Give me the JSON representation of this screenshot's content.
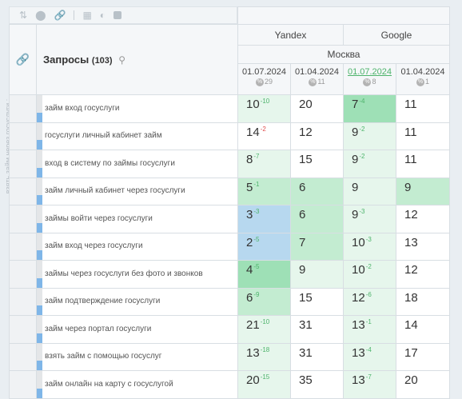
{
  "side_label": "взять займ через госуслуги :",
  "toolbar": {
    "icons": [
      "sort-icon",
      "toggle-icon",
      "link-icon",
      "calculator-icon",
      "contrast-icon",
      "font-icon"
    ]
  },
  "header": {
    "link_icon": "🔗",
    "title": "Запросы",
    "count": "(103)",
    "search_icon": "⚲",
    "engines": [
      "Yandex",
      "Google"
    ],
    "region": "Москва",
    "dates": [
      {
        "date": "01.07.2024",
        "count": "29",
        "highlighted": false
      },
      {
        "date": "01.04.2024",
        "count": "11",
        "highlighted": false
      },
      {
        "date": "01.07.2024",
        "count": "8",
        "highlighted": true
      },
      {
        "date": "01.04.2024",
        "count": "1",
        "highlighted": false
      }
    ],
    "badge_glyph": "%"
  },
  "colors": {
    "green_light": "#e6f6ec",
    "green_mid": "#c3ecd1",
    "green_strong": "#9ee0b6",
    "blue": "#b7d8ef",
    "white": "#ffffff"
  },
  "rows": [
    {
      "query": "займ вход госуслуги",
      "cells": [
        {
          "v": "10",
          "d": "-10",
          "bg": "green_light"
        },
        {
          "v": "20",
          "d": "",
          "bg": "white"
        },
        {
          "v": "7",
          "d": "-4",
          "bg": "green_strong"
        },
        {
          "v": "11",
          "d": "",
          "bg": "white"
        }
      ]
    },
    {
      "query": "госуслуги личный кабинет займ",
      "cells": [
        {
          "v": "14",
          "d": "-2",
          "dneg": true,
          "bg": "white"
        },
        {
          "v": "12",
          "d": "",
          "bg": "white"
        },
        {
          "v": "9",
          "d": "-2",
          "bg": "green_light"
        },
        {
          "v": "11",
          "d": "",
          "bg": "white"
        }
      ]
    },
    {
      "query": "вход в систему по займы госуслуги",
      "cells": [
        {
          "v": "8",
          "d": "-7",
          "bg": "green_light"
        },
        {
          "v": "15",
          "d": "",
          "bg": "white"
        },
        {
          "v": "9",
          "d": "-2",
          "bg": "green_light"
        },
        {
          "v": "11",
          "d": "",
          "bg": "white"
        }
      ]
    },
    {
      "query": "займ личный кабинет через госуслуги",
      "cells": [
        {
          "v": "5",
          "d": "-1",
          "bg": "green_mid"
        },
        {
          "v": "6",
          "d": "",
          "bg": "green_mid"
        },
        {
          "v": "9",
          "d": "",
          "bg": "green_light"
        },
        {
          "v": "9",
          "d": "",
          "bg": "green_mid"
        }
      ]
    },
    {
      "query": "займы войти через госуслуги",
      "cells": [
        {
          "v": "3",
          "d": "-3",
          "bg": "blue"
        },
        {
          "v": "6",
          "d": "",
          "bg": "green_mid"
        },
        {
          "v": "9",
          "d": "-3",
          "bg": "green_light"
        },
        {
          "v": "12",
          "d": "",
          "bg": "white"
        }
      ]
    },
    {
      "query": "займ вход через госуслуги",
      "cells": [
        {
          "v": "2",
          "d": "-5",
          "bg": "blue"
        },
        {
          "v": "7",
          "d": "",
          "bg": "green_mid"
        },
        {
          "v": "10",
          "d": "-3",
          "bg": "green_light"
        },
        {
          "v": "13",
          "d": "",
          "bg": "white"
        }
      ]
    },
    {
      "query": "займы через госуслуги без фото и звонков",
      "cells": [
        {
          "v": "4",
          "d": "-5",
          "bg": "green_strong"
        },
        {
          "v": "9",
          "d": "",
          "bg": "green_light"
        },
        {
          "v": "10",
          "d": "-2",
          "bg": "green_light"
        },
        {
          "v": "12",
          "d": "",
          "bg": "white"
        }
      ]
    },
    {
      "query": "займ подтверждение госуслуги",
      "cells": [
        {
          "v": "6",
          "d": "-9",
          "bg": "green_mid"
        },
        {
          "v": "15",
          "d": "",
          "bg": "white"
        },
        {
          "v": "12",
          "d": "-6",
          "bg": "green_light"
        },
        {
          "v": "18",
          "d": "",
          "bg": "white"
        }
      ]
    },
    {
      "query": "займ через портал госуслуги",
      "cells": [
        {
          "v": "21",
          "d": "-10",
          "bg": "green_light"
        },
        {
          "v": "31",
          "d": "",
          "bg": "white"
        },
        {
          "v": "13",
          "d": "-1",
          "bg": "green_light"
        },
        {
          "v": "14",
          "d": "",
          "bg": "white"
        }
      ]
    },
    {
      "query": "взять займ с помощью госуслуг",
      "cells": [
        {
          "v": "13",
          "d": "-18",
          "bg": "green_light"
        },
        {
          "v": "31",
          "d": "",
          "bg": "white"
        },
        {
          "v": "13",
          "d": "-4",
          "bg": "green_light"
        },
        {
          "v": "17",
          "d": "",
          "bg": "white"
        }
      ]
    },
    {
      "query": "займ онлайн на карту с госуслугой",
      "cells": [
        {
          "v": "20",
          "d": "-15",
          "bg": "green_light"
        },
        {
          "v": "35",
          "d": "",
          "bg": "white"
        },
        {
          "v": "13",
          "d": "-7",
          "bg": "green_light"
        },
        {
          "v": "20",
          "d": "",
          "bg": "white"
        }
      ]
    }
  ]
}
